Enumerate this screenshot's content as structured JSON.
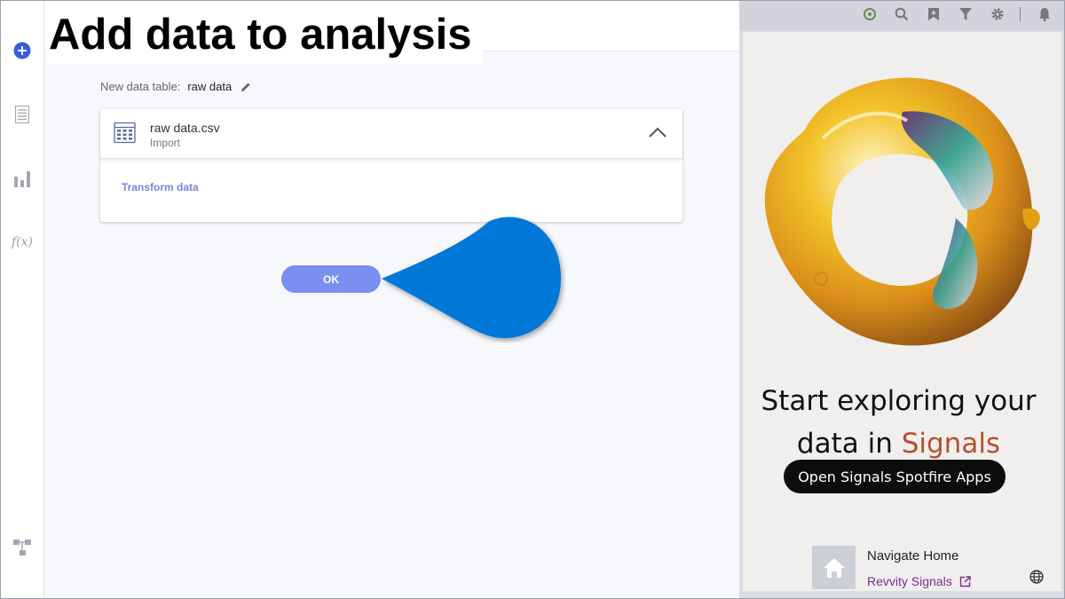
{
  "caption": "Add data to analysis",
  "data_table": {
    "label": "New data table:",
    "value": "raw data"
  },
  "source_card": {
    "file_name": "raw data.csv",
    "file_type": "Import",
    "transform_link": "Transform data"
  },
  "ok_button": "OK",
  "left_rail": {
    "icons": [
      "add-circle-icon",
      "data-table-icon",
      "bar-chart-icon",
      "function-icon",
      "data-flow-icon"
    ],
    "fx_label": "f(x)"
  },
  "top_bar_icons": [
    "bot-icon",
    "search-icon",
    "bookmark-icon",
    "filter-icon",
    "gear-icon",
    "bell-icon"
  ],
  "promo": {
    "title_line1": "Start exploring your",
    "title_line2_prefix": "data in ",
    "title_line2_accent": "Signals",
    "open_button": "Open Signals Spotfire Apps",
    "nav_home": "Navigate Home",
    "revvity_link": "Revvity Signals"
  },
  "colors": {
    "accent_blue": "#7b8ff0",
    "pointer_blue": "#0078d7",
    "add_icon_blue": "#3b5bdb",
    "link_purple": "#7b2d8f",
    "signals_orange": "#b4502d",
    "transform_link": "#7685d6"
  }
}
